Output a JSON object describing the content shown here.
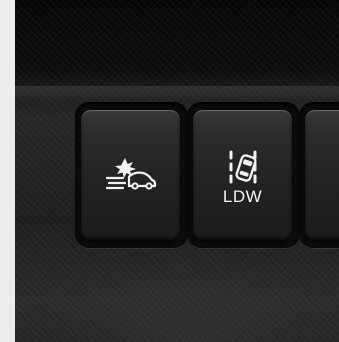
{
  "scene": {
    "buttons": [
      {
        "id": "forward-collision",
        "icon": "collision-warning-icon",
        "label": ""
      },
      {
        "id": "lane-departure",
        "icon": "lane-departure-icon",
        "label": "LDW"
      },
      {
        "id": "partial-button",
        "icon": "",
        "label": ""
      }
    ]
  },
  "colors": {
    "background": "#ececec",
    "panel": "#1f1f1f",
    "button": "#2a2a2a",
    "icon": "#f2f2f2"
  }
}
